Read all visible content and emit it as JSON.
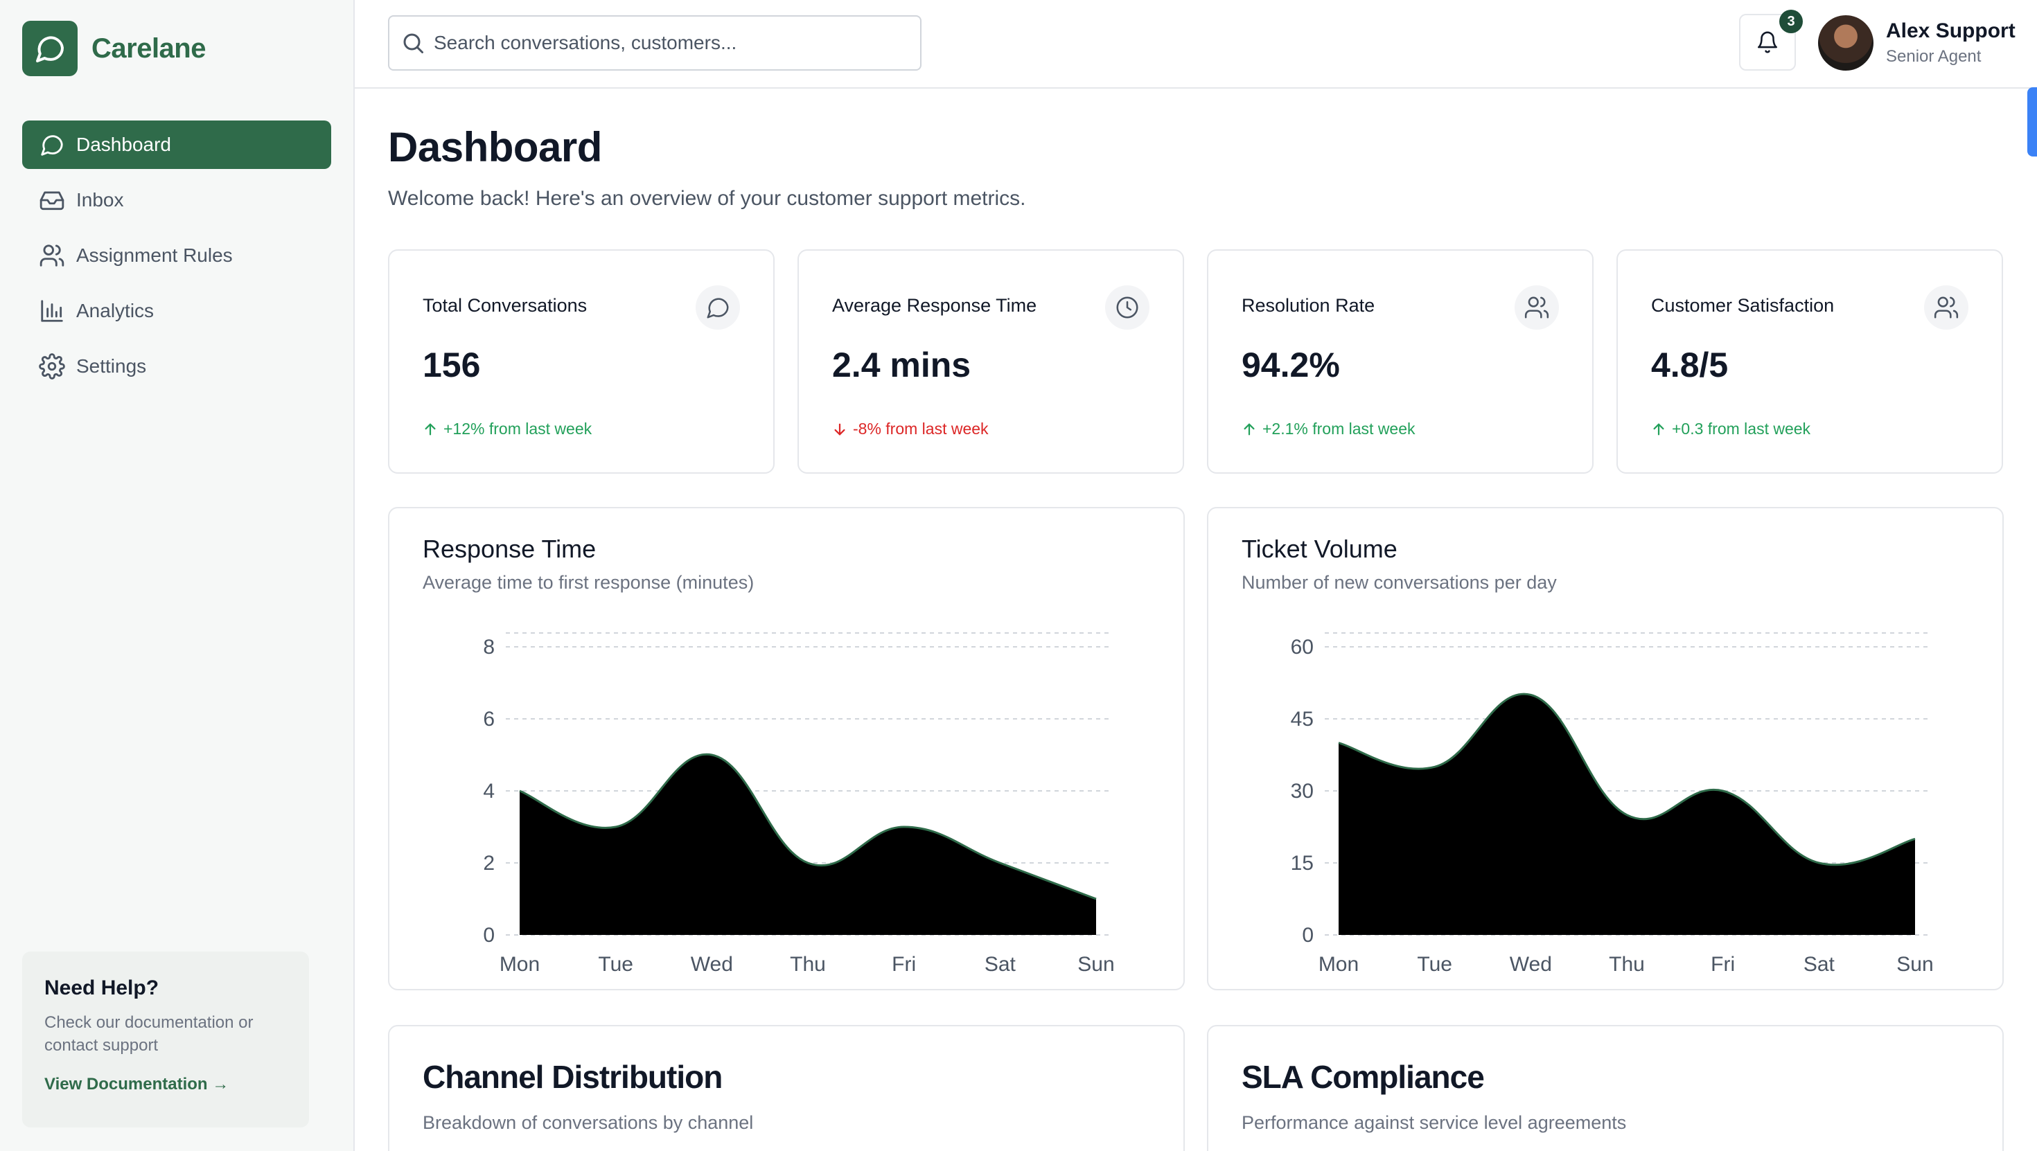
{
  "app": {
    "name": "Carelane"
  },
  "sidebar": {
    "items": [
      {
        "label": "Dashboard",
        "icon": "chat-icon",
        "active": true
      },
      {
        "label": "Inbox",
        "icon": "inbox-icon"
      },
      {
        "label": "Assignment Rules",
        "icon": "users-icon"
      },
      {
        "label": "Analytics",
        "icon": "bar-chart-icon"
      },
      {
        "label": "Settings",
        "icon": "gear-icon"
      }
    ],
    "help": {
      "title": "Need Help?",
      "text": "Check our documentation or contact support",
      "link": "View Documentation →"
    }
  },
  "header": {
    "search": {
      "placeholder": "Search conversations, customers...",
      "value": ""
    },
    "notifications": {
      "count": "3"
    },
    "user": {
      "name": "Alex Support",
      "role": "Senior Agent"
    }
  },
  "page": {
    "title": "Dashboard",
    "subtitle": "Welcome back! Here's an overview of your customer support metrics."
  },
  "stats": [
    {
      "label": "Total Conversations",
      "value": "156",
      "trend": "+12% from last week",
      "direction": "up",
      "icon": "chat-icon"
    },
    {
      "label": "Average Response Time",
      "value": "2.4 mins",
      "trend": "-8% from last week",
      "direction": "down",
      "icon": "clock-icon"
    },
    {
      "label": "Resolution Rate",
      "value": "94.2%",
      "trend": "+2.1% from last week",
      "direction": "up",
      "icon": "users-icon"
    },
    {
      "label": "Customer Satisfaction",
      "value": "4.8/5",
      "trend": "+0.3 from last week",
      "direction": "up",
      "icon": "users-icon"
    }
  ],
  "colors": {
    "brand": "#2f6b4a",
    "up": "#22a05a",
    "down": "#dc2626",
    "area": "#000000"
  },
  "chart_data": [
    {
      "type": "area",
      "title": "Response Time",
      "subtitle": "Average time to first response (minutes)",
      "categories": [
        "Mon",
        "Tue",
        "Wed",
        "Thu",
        "Fri",
        "Sat",
        "Sun"
      ],
      "values": [
        4,
        3,
        5,
        2,
        3,
        2,
        1
      ],
      "yticks": [
        0,
        2,
        4,
        6,
        8
      ],
      "ylim": [
        0,
        8
      ],
      "grid": true
    },
    {
      "type": "area",
      "title": "Ticket Volume",
      "subtitle": "Number of new conversations per day",
      "categories": [
        "Mon",
        "Tue",
        "Wed",
        "Thu",
        "Fri",
        "Sat",
        "Sun"
      ],
      "values": [
        40,
        35,
        50,
        25,
        30,
        15,
        20
      ],
      "yticks": [
        0,
        15,
        30,
        45,
        60
      ],
      "ylim": [
        0,
        60
      ],
      "grid": true
    }
  ],
  "sections": [
    {
      "title": "Channel Distribution",
      "subtitle": "Breakdown of conversations by channel"
    },
    {
      "title": "SLA Compliance",
      "subtitle": "Performance against service level agreements"
    }
  ]
}
